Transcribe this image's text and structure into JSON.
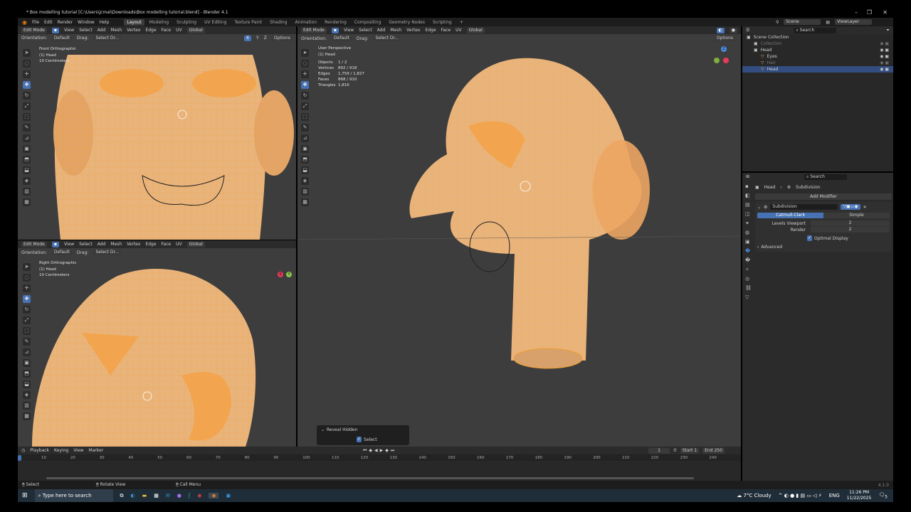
{
  "window": {
    "title": "* Box modelling tutorial [C:\\Users\\jcmal\\Downloads\\Box modelling tutorial.blend] - Blender 4.1",
    "controls": [
      "–",
      "❐",
      "✕"
    ]
  },
  "topmenu": {
    "menus": [
      "File",
      "Edit",
      "Render",
      "Window",
      "Help"
    ],
    "workspaces": [
      "Layout",
      "Modeling",
      "Sculpting",
      "UV Editing",
      "Texture Paint",
      "Shading",
      "Animation",
      "Rendering",
      "Compositing",
      "Geometry Nodes",
      "Scripting",
      "+"
    ],
    "active_workspace": "Layout",
    "scene": "Scene",
    "view_layer": "ViewLayer"
  },
  "viewport_header": {
    "mode": "Edit Mode",
    "menus": [
      "View",
      "Select",
      "Add",
      "Mesh",
      "Vertex",
      "Edge",
      "Face",
      "UV"
    ],
    "transform": "Global",
    "orientation_label": "Orientation:",
    "orientation_value": "Default",
    "drag_label": "Drag:",
    "drag_value": "Select Dr...",
    "options": "Options",
    "axes": [
      "X",
      "Y",
      "Z"
    ]
  },
  "viewports": {
    "front": {
      "view": "Front Orthographic",
      "object": "(1) Head",
      "scale": "10 Centimeters"
    },
    "right": {
      "view": "Right Orthographic",
      "object": "(1) Head",
      "scale": "10 Centimeters"
    },
    "user": {
      "view": "User Perspective",
      "object": "(1) Head",
      "stats": [
        {
          "label": "Objects",
          "value": "1 / 2"
        },
        {
          "label": "Vertices",
          "value": "892 / 918"
        },
        {
          "label": "Edges",
          "value": "1,759 / 1,827"
        },
        {
          "label": "Faces",
          "value": "868 / 910"
        },
        {
          "label": "Triangles",
          "value": "1,816"
        }
      ]
    }
  },
  "operator_panel": {
    "title": "Reveal Hidden",
    "select_label": "Select",
    "select_checked": true
  },
  "outliner": {
    "search_placeholder": "Search",
    "root": "Scene Collection",
    "items": [
      {
        "name": "Collection",
        "depth": 1
      },
      {
        "name": "Head",
        "depth": 1
      },
      {
        "name": "Eyes",
        "depth": 2
      },
      {
        "name": "Hair",
        "depth": 2
      },
      {
        "name": "Head",
        "depth": 2,
        "selected": true
      }
    ]
  },
  "properties": {
    "search_placeholder": "Search",
    "breadcrumb": [
      "Head",
      "Subdivision"
    ],
    "add_modifier": "Add Modifier",
    "modifier_name": "Subdivision",
    "type_options": [
      "Catmull-Clark",
      "Simple"
    ],
    "active_type": "Catmull-Clark",
    "levels_viewport_label": "Levels Viewport",
    "levels_viewport": "2",
    "render_label": "Render",
    "render": "2",
    "optimal_display_label": "Optimal Display",
    "optimal_display": true,
    "advanced": "Advanced"
  },
  "timeline": {
    "menus": [
      "Playback",
      "Keying",
      "View",
      "Marker"
    ],
    "current_frame": "1",
    "start_label": "Start",
    "start": "1",
    "end_label": "End",
    "end": "250",
    "ticks": [
      "10",
      "20",
      "30",
      "40",
      "50",
      "60",
      "70",
      "80",
      "90",
      "100",
      "110",
      "120",
      "130",
      "140",
      "150",
      "160",
      "170",
      "180",
      "190",
      "200",
      "210",
      "220",
      "230",
      "240"
    ]
  },
  "statusbar": {
    "hints": [
      "Select",
      "Rotate View",
      "Call Menu"
    ],
    "version": "4.1.0"
  },
  "taskbar": {
    "search_placeholder": "Type here to search",
    "weather": "7°C  Cloudy",
    "language": "ENG",
    "time": "11:26 PM",
    "date": "11/22/2025",
    "notifications": "5"
  },
  "colors": {
    "accent": "#4772b3",
    "mesh": "#e8a35c",
    "wire": "#f0a030",
    "viewport_bg": "#3d3d3d"
  }
}
